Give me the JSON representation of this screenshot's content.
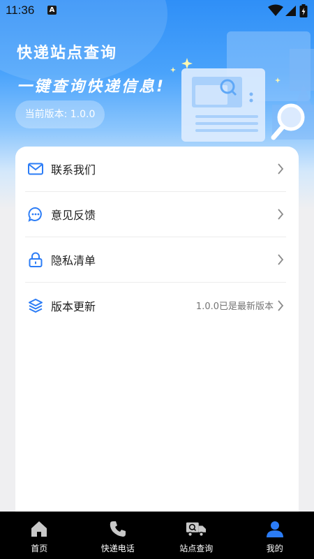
{
  "status_bar": {
    "time": "11:36",
    "notification_icon": "a-icon"
  },
  "header": {
    "title": "快递站点查询",
    "slogan": "一键查询快递信息!",
    "version_label": "当前版本: 1.0.0"
  },
  "menu": {
    "items": [
      {
        "label": "联系我们",
        "icon": "mail-icon"
      },
      {
        "label": "意见反馈",
        "icon": "chat-bubble-icon"
      },
      {
        "label": "隐私清单",
        "icon": "lock-icon"
      },
      {
        "label": "版本更新",
        "icon": "layers-icon",
        "extra": "1.0.0已是最新版本"
      }
    ]
  },
  "tabbar": {
    "tabs": [
      {
        "label": "首页",
        "icon": "home-icon",
        "active": false
      },
      {
        "label": "快递电话",
        "icon": "phone-icon",
        "active": false
      },
      {
        "label": "站点查询",
        "icon": "truck-search-icon",
        "active": false
      },
      {
        "label": "我的",
        "icon": "user-icon",
        "active": true
      }
    ]
  },
  "colors": {
    "accent": "#2f8ff7",
    "active_tab": "#2b7cf6",
    "inactive_tab_icon": "#c8c8c8",
    "tabbar_bg": "#000000",
    "icon_blue": "#2b7cf6"
  }
}
